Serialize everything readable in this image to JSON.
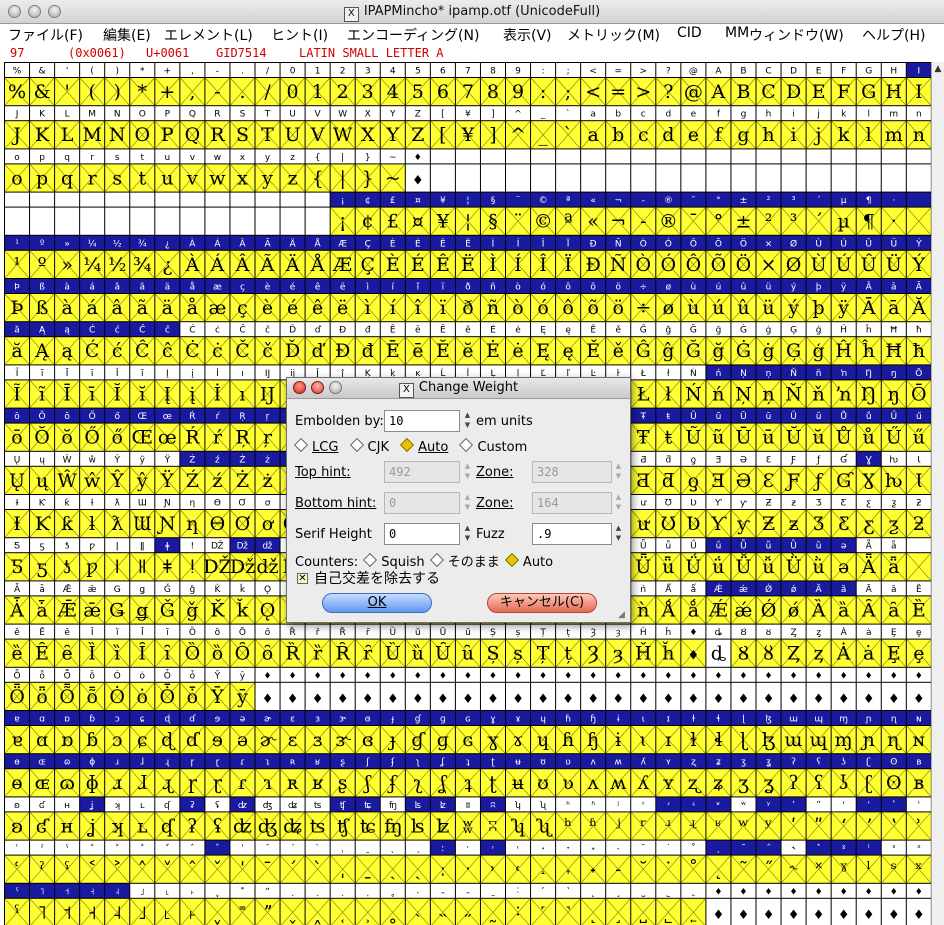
{
  "window": {
    "title": "IPAPMincho*  ipamp.otf (UnicodeFull)"
  },
  "menubar": {
    "items": [
      "ファイル(F)",
      "編集(E)",
      "エレメント(L)",
      "ヒント(I)",
      "エンコーディング(N)",
      "表示(V)",
      "メトリック(M)",
      "CID",
      "MM",
      "ウィンドウ(W)",
      "ヘルプ(H)"
    ]
  },
  "infobar": {
    "decimal": "97",
    "hex": "(0x0061)",
    "unicode": "U+0061",
    "gid": "GID7514",
    "name": "LATIN SMALL LETTER A"
  },
  "colors": {
    "cell_filled": "#ffff33",
    "cell_empty": "#ffffff",
    "header_normal": "#ffffff",
    "header_selected": "#1a1aa0",
    "grid_line": "#000000",
    "cross": "#7a7a00",
    "info_text": "#d00000"
  },
  "glyph_grid": {
    "rows": [
      {
        "glyphs": "%&'()*+,-./0123456789:;<=>?@ABCDEFGHI",
        "filled": "1111111111111111111111111111111111111",
        "selected": "0000000000000000000000000000000000001"
      },
      {
        "glyphs": "JKLMNOPQRSTUVWXYZ[¥]^_`abcdefghijklmn",
        "filled": "1111111111111111111111111111111111111",
        "selected": "0000000000000000000000000000000000000"
      },
      {
        "glyphs": "opqrstuvwxyz{|}~♦",
        "filled": "11111111111111110",
        "selected": "00000000000000000"
      },
      {
        "glyphs": "             ¡¢£¤¥¦§¨©ª«¬-®¯°±²³´µ¶·",
        "filled": "0000000000000111111111111111111111111",
        "selected": "0000000000000111111111111111111111111"
      },
      {
        "glyphs": "¹º»¼½¾¿ÀÁÂÃÄÅÆÇÈÉÊËÌÍÎÏÐÑÒÓÔÕÖ×ØÙÚÛÜÝ",
        "filled": "1111111111111111111111111111111111111",
        "selected": "1111111111111111111111111111111111111"
      },
      {
        "glyphs": "Þßàáâãäåæçèéêëìíîïðñòóôõö÷øùúûüýþÿĀāĂ",
        "filled": "1111111111111111111111111111111111111",
        "selected": "1111111111111111111111111111111111111"
      },
      {
        "glyphs": "ăĄąĆćĈĉĊċČčĎďĐđĒēĔĕĖėĘęĚěĜĝĞğĠġĢģĤĥĦħ",
        "filled": "1111111111111111111111111111111111111",
        "selected": "1111111000000000000000000000000000000"
      },
      {
        "glyphs": "ĨĩĪīĬĭĮįİıĲĳĴĵĶķĸĹĺĻļĽľĿŀŁłŃńŅņŇňŉŊŋŌ",
        "filled": "1111111111111111111111111111111111111",
        "selected": "0000000000000000000000000000111111111"
      },
      {
        "glyphs": "ōŎŏŐőŒœŔŕŖŗŘřŚśŜŝŞşŠšŢţŤťŦŧŨũŪūŬŭŮůŰű",
        "filled": "1111111111111111111111111111111111111",
        "selected": "1111111111111111111111111111111111111"
      },
      {
        "glyphs": "ŲųŴŵŶŷŸŹźŻżŽžſƀƁƂƃƄƅƆƇƈƉƊƋƌƍƎƏƐƑƒƓƔƕƖ",
        "filled": "1111111111111111111111111111111111111",
        "selected": "0000000111111000000000000000000000100"
      },
      {
        "glyphs": "ƗƘƙƚƛƜƝƞƟƠơƢƣƤƥƦƧƨƩƪƫƬƭƮƯưƱƲƳƴƵƶƷƸƹƺƻ",
        "filled": "1111111111111111111111111111111111111",
        "selected": "0000000000000000000000000000000000000"
      },
      {
        "glyphs": "ƼƽƾƿǀǁǂǃǄǅǆǇǈǉǊǋǌǍǎǏǐǑǒǓǔǕǖǗǘǙǚǛǜǝǞǟ",
        "filled": "1111111111111111111111111111111111111",
        "selected": "0000001001100000000000000000111111000"
      },
      {
        "glyphs": "ǠǡǢǣǤǥǦǧǨǩǪǫǬǭǮǯǰǱǲǳǴǵǶǷǸǹǺǻǼǽǾǿȀȁȂȃȄ",
        "filled": "1111111111111111111111111111111111111",
        "selected": "0000000000000000000000000000111111000"
      },
      {
        "glyphs": "ȅȆȇȈȉȊȋȌȍȎȏȐȑȒȓȔȕȖȗȘșȚțȜȝȞȟ♦ȡȢȣȤȥȦȧȨȩ",
        "filled": "1111111111111111111111111111011111111",
        "selected": "0000000000000000000000000000000000000"
      },
      {
        "glyphs": "ȪȫȬȭȮȯȰȱȲȳ♦♦♦♦♦♦♦♦♦♦♦♦♦♦♦♦♦♦♦♦♦♦♦♦♦♦♦",
        "filled": "1111111111000000000000000000000000000",
        "selected": "0000000000000000000000000000000000000"
      },
      {
        "glyphs": "ɐɑɒɓɔɕɖɗɘəɚɛɜɝɞɟɠɡɢɣɤɥɦɧɨɩɪɫɬɭɮɯɰɱɲɳɴ",
        "filled": "1111111111111111111111111111111111111",
        "selected": "1111111111111111111111111111111111111"
      },
      {
        "glyphs": "ɵɶɷɸɹɺɻɼɽɾɿʀʁʂʃʄʅʆʇʈʉʊʋʌʍʎʏʐʑʒʓʔʕʖʗʘʙ",
        "filled": "1111111111111111111111111111111111111",
        "selected": "1111111111111111111111111111111111111"
      },
      {
        "glyphs": "ʚʛʜʝʞʟʠʡʢʣʤʥʦʧʨʩʪʫʬʭʮʯʰʱʲʳʴʵʶʷʸʹʺʻʼʽʾ",
        "filled": "1111111111111111111111111111111111111",
        "selected": "0001000101000110110100000011101100110"
      },
      {
        "glyphs": "ʿˀˁ˂˃˄˅ˆˇˈˉˊˋˌˍˎˏːˑ˒˓˔˕˖˗˘˙˚˛˜˝˞˟ˠˡˢˣ",
        "filled": "1111111111111111111111111111111111111",
        "selected": "0000000010000000010100000000111011100"
      },
      {
        "glyphs": "ˤ˥˦˧˨˩˪˫ˬ˭ˮ˯˰˱˲˳˴˵˶˷˸˹˺˻˼˽˾˿♦♦♦♦♦♦♦♦♦",
        "filled": "1111111111111111111111111111000000000",
        "selected": "1111100000000000000000000000000000000"
      }
    ]
  },
  "dialog": {
    "title": "Change Weight",
    "embolden_label": "Embolden by:",
    "embolden_value": "10",
    "embolden_units": "em units",
    "modes": [
      "LCG",
      "CJK",
      "Auto",
      "Custom"
    ],
    "selected_mode": "Auto",
    "top_hint_label": "Top hint:",
    "top_hint_value": "492",
    "zone_label": "Zone:",
    "top_zone_value": "328",
    "bottom_hint_label": "Bottom hint:",
    "bottom_hint_value": "0",
    "bottom_zone_value": "164",
    "serif_label": "Serif Height",
    "serif_value": "0",
    "fuzz_label": "Fuzz",
    "fuzz_value": ".9",
    "counters_label": "Counters:",
    "counter_options": [
      "Squish",
      "そのまま",
      "Auto"
    ],
    "selected_counter": "Auto",
    "remove_overlap_label": "自己交差を除去する",
    "remove_overlap_checked": true,
    "ok_label": "OK",
    "cancel_label": "キャンセル(C)"
  }
}
